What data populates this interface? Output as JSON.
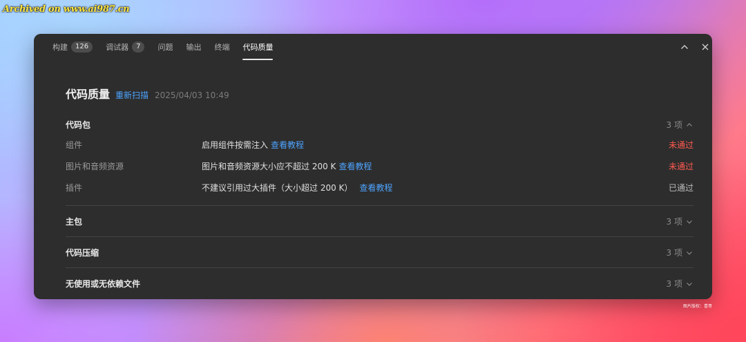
{
  "watermark": "Archived on www.ai987.cn",
  "credit": "图片版权：喜哥",
  "tabs": [
    {
      "label": "构建",
      "badge": "126",
      "active": false
    },
    {
      "label": "调试器",
      "badge": "7",
      "active": false
    },
    {
      "label": "问题",
      "badge": "",
      "active": false
    },
    {
      "label": "输出",
      "badge": "",
      "active": false
    },
    {
      "label": "终端",
      "badge": "",
      "active": false
    },
    {
      "label": "代码质量",
      "badge": "",
      "active": true
    }
  ],
  "panel_controls": {
    "collapse_icon": "chevron-up-icon",
    "close_icon": "close-icon"
  },
  "header": {
    "title": "代码质量",
    "rescan_label": "重新扫描",
    "timestamp": "2025/04/03 10:49"
  },
  "sections": [
    {
      "name": "代码包",
      "count": "3 项",
      "expanded": true,
      "rows": [
        {
          "label": "组件",
          "desc": "启用组件按需注入",
          "link": "查看教程",
          "status": "未通过",
          "status_type": "fail"
        },
        {
          "label": "图片和音频资源",
          "desc": "图片和音频资源大小应不超过 200 K",
          "link": "查看教程",
          "status": "未通过",
          "status_type": "fail"
        },
        {
          "label": "插件",
          "desc": "不建议引用过大插件（大小超过 200 K）",
          "link": "查看教程",
          "status": "已通过",
          "status_type": "pass"
        }
      ]
    },
    {
      "name": "主包",
      "count": "3 项",
      "expanded": false
    },
    {
      "name": "代码压缩",
      "count": "3 项",
      "expanded": false
    },
    {
      "name": "无使用或无依赖文件",
      "count": "3 项",
      "expanded": false
    }
  ],
  "colors": {
    "accent": "#4ea3ff",
    "fail": "#ff5a4f",
    "pass": "#bdbdbd",
    "panel_bg": "#2d2d2d"
  }
}
